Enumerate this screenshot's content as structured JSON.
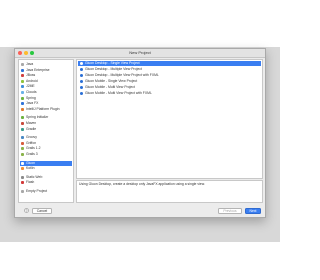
{
  "window": {
    "title": "New Project"
  },
  "sidebar": {
    "items": [
      {
        "label": "Java",
        "icon": "folder-icon",
        "color": "#a8a8a8"
      },
      {
        "label": "Java Enterprise",
        "icon": "java-ee-icon",
        "color": "#2f73d9"
      },
      {
        "label": "JBoss",
        "icon": "jboss-icon",
        "color": "#d13f3f"
      },
      {
        "label": "Android",
        "icon": "android-icon",
        "color": "#8fc43c"
      },
      {
        "label": "J2ME",
        "icon": "j2me-icon",
        "color": "#3f8fd9"
      },
      {
        "label": "Clouds",
        "icon": "cloud-icon",
        "color": "#6ab2e8"
      },
      {
        "label": "Spring",
        "icon": "spring-icon",
        "color": "#6db33f"
      },
      {
        "label": "Java FX",
        "icon": "javafx-icon",
        "color": "#2f73d9"
      },
      {
        "label": "IntelliJ Platform Plugin",
        "icon": "plugin-icon",
        "color": "#e17a2d"
      },
      {
        "label": "Spring Initializr",
        "icon": "spring-initializr-icon",
        "color": "#6db33f"
      },
      {
        "label": "Maven",
        "icon": "maven-icon",
        "color": "#c94a3c"
      },
      {
        "label": "Gradle",
        "icon": "gradle-icon",
        "color": "#3b9c8d"
      },
      {
        "label": "Groovy",
        "icon": "groovy-icon",
        "color": "#4a89c5"
      },
      {
        "label": "Griffon",
        "icon": "griffon-icon",
        "color": "#d85d3d"
      },
      {
        "label": "Grails 1.2",
        "icon": "grails-icon",
        "color": "#8ab34a"
      },
      {
        "label": "Grails 3",
        "icon": "grails-icon",
        "color": "#8ab34a"
      },
      {
        "label": "Gluon",
        "icon": "gluon-icon",
        "color": "#ffffff",
        "selected": true
      },
      {
        "label": "Kotlin",
        "icon": "kotlin-icon",
        "color": "#f18e33"
      },
      {
        "label": "Static Web",
        "icon": "static-web-icon",
        "color": "#8b8b8b"
      },
      {
        "label": "Flash",
        "icon": "flash-icon",
        "color": "#d23a3a"
      },
      {
        "label": "Empty Project",
        "icon": "empty-project-icon",
        "color": "#a8a8a8"
      }
    ]
  },
  "templates": {
    "items": [
      {
        "label": "Gluon Desktop - Single View Project",
        "selected": true
      },
      {
        "label": "Gluon Desktop - Multiple View Project"
      },
      {
        "label": "Gluon Desktop - Multiple View Project with FXML"
      },
      {
        "label": "Gluon Mobile - Single View Project"
      },
      {
        "label": "Gluon Mobile - Multi View Project"
      },
      {
        "label": "Gluon Mobile - Multi View Project with FXML"
      }
    ]
  },
  "description": {
    "text": "Using Gluon Desktop, create a desktop only JavaFX application using a single view."
  },
  "footer": {
    "help_label": "?",
    "cancel_label": "Cancel",
    "previous_label": "Previous",
    "next_label": "Next"
  },
  "colors": {
    "accent": "#3a7ef1",
    "traffic_close": "#fc5f57",
    "traffic_min": "#fdbc2e",
    "traffic_max": "#28c840"
  }
}
